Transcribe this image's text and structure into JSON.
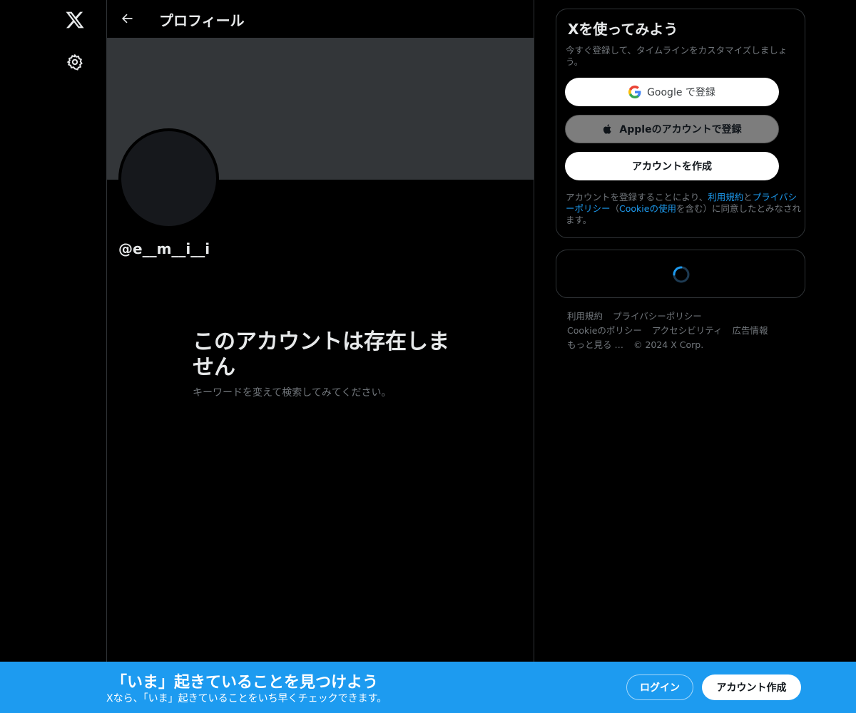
{
  "header": {
    "title": "プロフィール"
  },
  "profile": {
    "handle": "@e__m__i__i"
  },
  "empty_state": {
    "title": "このアカウントは存在しません",
    "subtitle": "キーワードを変えて検索してみてください。"
  },
  "signup": {
    "title": "Xを使ってみよう",
    "description": "今すぐ登録して、タイムラインをカスタマイズしましょう。",
    "google_label": "Google で登録",
    "apple_label": "Appleのアカウントで登録",
    "create_label": "アカウントを作成",
    "legal_prefix": "アカウントを登録することにより、",
    "legal_terms": "利用規約",
    "legal_and": "と",
    "legal_privacy": "プライバシーポリシー",
    "legal_paren_open": "（",
    "legal_cookie": "Cookieの使用",
    "legal_suffix": "を含む）に同意したとみなされます。"
  },
  "footer": {
    "links": [
      "利用規約",
      "プライバシーポリシー",
      "Cookieのポリシー",
      "アクセシビリティ",
      "広告情報",
      "もっと見る …"
    ],
    "copyright": "© 2024 X Corp."
  },
  "bottom_bar": {
    "title": "「いま」起きていることを見つけよう",
    "subtitle": "Xなら、「いま」起きていることをいち早くチェックできます。",
    "login_label": "ログイン",
    "create_label": "アカウント作成"
  },
  "colors": {
    "accent": "#1d9bf0",
    "banner": "#333639",
    "border": "#2f3336",
    "muted_text": "#71767b"
  },
  "icons": {
    "logo": "x-logo-icon",
    "settings": "gear-icon",
    "back": "arrow-left-icon",
    "google": "google-icon",
    "apple": "apple-icon",
    "loading": "spinner-icon"
  }
}
